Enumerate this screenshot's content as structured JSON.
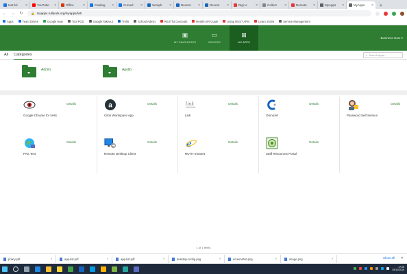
{
  "browser": {
    "tabs": [
      {
        "label": "test-fol",
        "color": "#1a73e8"
      },
      {
        "label": "YouTube",
        "color": "#ff0000"
      },
      {
        "label": "Office",
        "color": "#d83b01"
      },
      {
        "label": "Catalog",
        "color": "#1a73e8"
      },
      {
        "label": "Curved",
        "color": "#1a73e8"
      },
      {
        "label": "Seraph",
        "color": "#1565c0"
      },
      {
        "label": "Recent",
        "color": "#1565c0"
      },
      {
        "label": "Recent",
        "color": "#1565c0"
      },
      {
        "label": "Digi-U",
        "color": "#e53935"
      },
      {
        "label": "Collect",
        "color": "#80868b"
      },
      {
        "label": "Remote",
        "color": "#e53935"
      },
      {
        "label": "MyApps",
        "color": "#5f6368"
      },
      {
        "label": "MyApps",
        "color": "#5f6368",
        "active": true
      }
    ],
    "url": "myapps.rutlands.org/myapps/list/",
    "bookmarks": [
      {
        "label": "Apps",
        "color": "#1a73e8"
      },
      {
        "label": "Team Drives",
        "color": "#1a73e8"
      },
      {
        "label": "Google Now",
        "color": "#34a853"
      },
      {
        "label": "Tool POS",
        "color": "#5f6368"
      },
      {
        "label": "Google Takeout",
        "color": "#5f6368"
      },
      {
        "label": "Trello",
        "color": "#1565c0"
      },
      {
        "label": "School Admin",
        "color": "#5f6368"
      },
      {
        "label": "RESTful concepts",
        "color": "#e53935"
      },
      {
        "label": "Health API Guide",
        "color": "#e53935"
      },
      {
        "label": "Using REST APIs",
        "color": "#e53935"
      },
      {
        "label": "Learn JSON",
        "color": "#e53935"
      },
      {
        "label": "Service Management",
        "color": "#5f6368"
      }
    ]
  },
  "header": {
    "nav": [
      {
        "label": "MY FAVOURITES",
        "icon": "▣"
      },
      {
        "label": "DEVICES",
        "icon": "▭"
      },
      {
        "label": "MY APPS",
        "icon": "⊞",
        "active": true
      }
    ],
    "user": "Business User"
  },
  "subbar": {
    "tab_all": "All",
    "tab_categories": "Categories",
    "search_placeholder": "Search Apps..."
  },
  "folders": [
    {
      "label": "Admin"
    },
    {
      "label": "Apollo"
    }
  ],
  "details_label": "Details",
  "apps": [
    {
      "name": "Google Chrome for NHS",
      "icon": "eye-icon"
    },
    {
      "name": "Citrix Workspace App",
      "icon": "access-icon"
    },
    {
      "name": "Link",
      "icon": "link-icon"
    },
    {
      "name": "Omnicell",
      "icon": "omnicell-icon"
    },
    {
      "name": "Password Self Service",
      "icon": "password-icon"
    },
    {
      "name": "PAS Test",
      "icon": "pas-icon"
    },
    {
      "name": "Remote Desktop Client",
      "icon": "remote-desktop-icon"
    },
    {
      "name": "RUTH Intranet",
      "icon": "ie-icon"
    },
    {
      "name": "Staff Resources Portal",
      "icon": "portal-icon"
    }
  ],
  "page_center": "1 of 1 items",
  "downloads": [
    {
      "label": "policy.pdf"
    },
    {
      "label": "app-list.pdf"
    },
    {
      "label": "app-list.pdf"
    },
    {
      "label": "desktop-config.png"
    },
    {
      "label": "screenshot.png"
    },
    {
      "label": "image.png"
    }
  ],
  "download_show_all": "Show all",
  "taskbar_time": "17:05",
  "taskbar_date": "03/12/2019"
}
